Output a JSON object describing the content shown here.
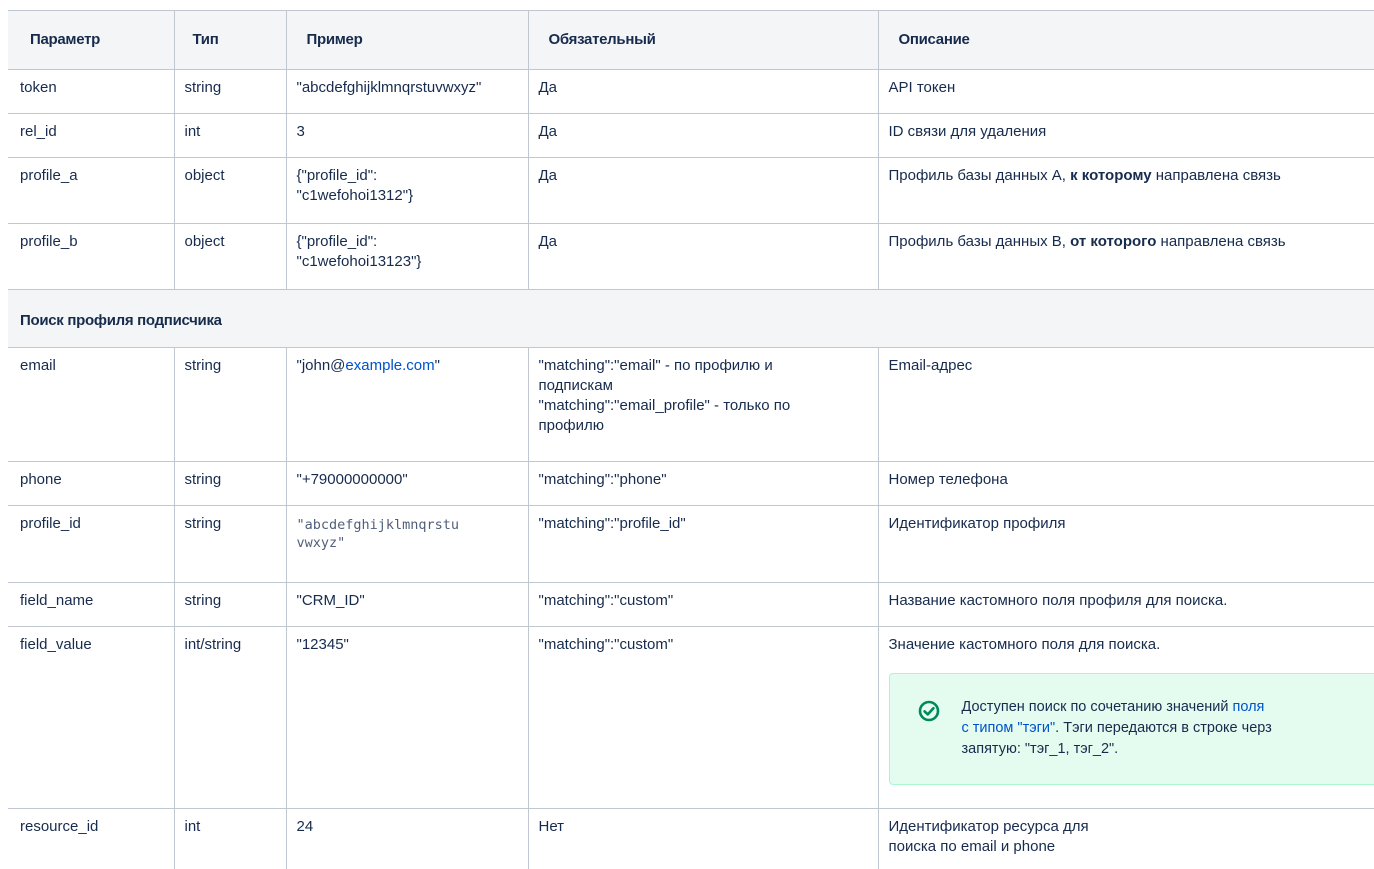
{
  "headers": [
    "Параметр",
    "Тип",
    "Пример",
    "Обязательный",
    "Описание"
  ],
  "rows": [
    {
      "param": "token",
      "type": "string",
      "example": "\"abcdefghijklmnqrstuvwxyz\"",
      "required": "Да",
      "desc": "API токен"
    },
    {
      "param": "rel_id",
      "type": "int",
      "example": "3",
      "required": "Да",
      "desc": "ID связи для удаления"
    },
    {
      "param": "profile_a",
      "type": "object",
      "example_1": "{\"profile_id\":",
      "example_2": "\"c1wefohoi1312\"}",
      "required": "Да",
      "desc_pre": "Профиль базы данных А, ",
      "desc_bold": "к которому",
      "desc_post": " направлена связь"
    },
    {
      "param": "profile_b",
      "type": "object",
      "example_1": "{\"profile_id\":",
      "example_2": "\"c1wefohoi13123\"}",
      "required": "Да",
      "desc_pre": "Профиль базы данных В, ",
      "desc_bold": "от которого",
      "desc_post": " направлена связь"
    }
  ],
  "section_title": "Поиск профиля подписчика",
  "search_rows": {
    "email": {
      "param": "email",
      "type": "string",
      "example_pre": "\"john@",
      "example_link": "example.com",
      "example_post": "\"",
      "required_1": "\"matching\":\"email\" - по профилю и",
      "required_2": "подпискам",
      "required_3": "\"matching\":\"email_profile\" - только по",
      "required_4": "профилю",
      "desc": "Email-адрес"
    },
    "phone": {
      "param": "phone",
      "type": "string",
      "example": "\"+79000000000\"",
      "required": "\"matching\":\"phone\"",
      "desc": "Номер телефона"
    },
    "profile_id": {
      "param": "profile_id",
      "type": "string",
      "example_1": "\"abcdefghijklmnqrstu",
      "example_2": "vwxyz\"",
      "required": "\"matching\":\"profile_id\"",
      "desc": "Идентификатор профиля"
    },
    "field_name": {
      "param": "field_name",
      "type": "string",
      "example": "\"CRM_ID\"",
      "required": "\"matching\":\"custom\"",
      "desc": "Название кастомного поля профиля для поиска."
    },
    "field_value": {
      "param": "field_value",
      "type": "int/string",
      "example": "\"12345\"",
      "required": "\"matching\":\"custom\"",
      "desc": "Значение кастомного поля для поиска.",
      "note_pre": "Доступен поиск по сочетанию значений ",
      "note_link_1": "поля",
      "note_link_2": "с типом \"тэги\"",
      "note_post_1": ". Тэги передаются в строке черз",
      "note_post_2": "запятую: \"тэг_1, тэг_2\"."
    },
    "resource_id": {
      "param": "resource_id",
      "type": "int",
      "example": "24",
      "required": "Нет",
      "desc_1": "Идентификатор ресурса для",
      "desc_2": "поиска по email и phone"
    }
  },
  "colors": {
    "note_icon": "#00875a",
    "link": "#0052cc",
    "header_bg": "#f4f5f7"
  }
}
